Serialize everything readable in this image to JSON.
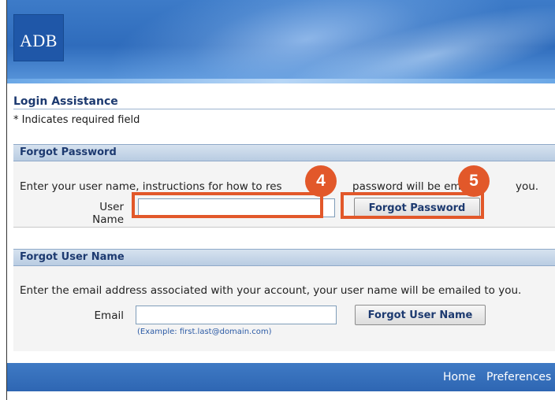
{
  "header": {
    "logo_text": "ADB"
  },
  "page": {
    "title": "Login Assistance",
    "required_note": "* Indicates required field"
  },
  "forgot_password": {
    "section_title": "Forgot Password",
    "instructions_part1": "Enter your user name, instructions for how to res",
    "instructions_part2": "password will be ema",
    "instructions_part3": "you.",
    "username_label": "User Name",
    "username_value": "",
    "button_label": "Forgot Password"
  },
  "forgot_username": {
    "section_title": "Forgot User Name",
    "instructions": "Enter the email address associated with your account, your user name will be emailed to you.",
    "email_label": "Email",
    "email_value": "",
    "email_example": "(Example: first.last@domain.com)",
    "button_label": "Forgot User Name"
  },
  "callouts": {
    "badge_4": "4",
    "badge_5": "5",
    "color": "#e2582a"
  },
  "footer": {
    "home_link": "Home",
    "preferences_link": "Preferences"
  }
}
